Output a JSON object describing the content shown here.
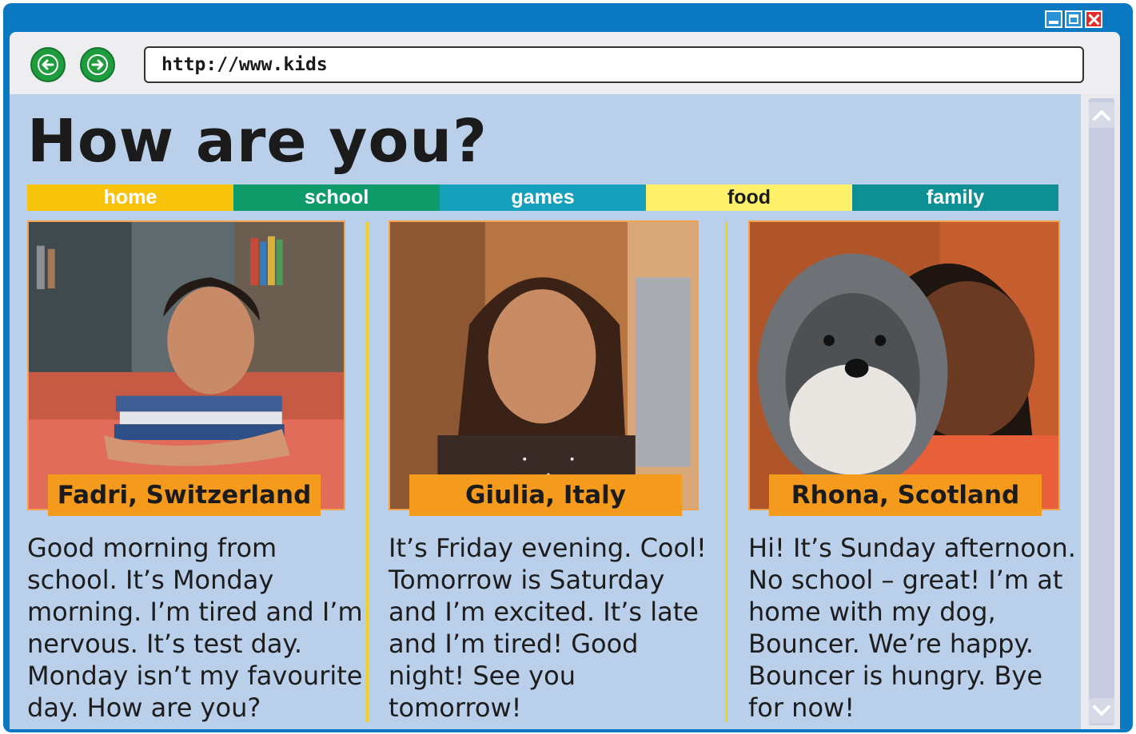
{
  "browser": {
    "url": "http://www.kids"
  },
  "page": {
    "title": "How are you?",
    "tabs": [
      {
        "label": "home"
      },
      {
        "label": "school"
      },
      {
        "label": "games"
      },
      {
        "label": "food"
      },
      {
        "label": "family"
      }
    ]
  },
  "profiles": [
    {
      "name": "Fadri, Switzerland",
      "message": "Good morning from school. It’s Monday morning. I’m tired and I’m nervous. It’s test day. Monday isn’t my favourite day. How are you?"
    },
    {
      "name": "Giulia, Italy",
      "message": "It’s Friday evening. Cool! Tomorrow is Saturday and I’m excited. It’s late and I’m tired! Good night! See you tomorrow!"
    },
    {
      "name": "Rhona, Scotland",
      "message": "Hi! It’s Sunday afternoon. No school – great! I’m at home with my dog, Bouncer. We’re happy. Bouncer is hungry. Bye for now!"
    }
  ],
  "icons": {
    "back": "arrow-left-icon",
    "forward": "arrow-right-icon",
    "scroll_up": "chevron-up-icon",
    "scroll_down": "chevron-down-icon",
    "minimize": "minimize-icon",
    "maximize": "maximize-icon",
    "close": "close-icon"
  },
  "colors": {
    "window_frame": "#0b79c2",
    "content_bg": "#b9cfea",
    "tab_home": "#f8c40b",
    "tab_school": "#0f9a6a",
    "tab_games": "#16a0bc",
    "tab_food": "#fff16a",
    "tab_family": "#0e8f93",
    "name_badge": "#f49a1c",
    "nav_button": "#1e9c3e"
  }
}
